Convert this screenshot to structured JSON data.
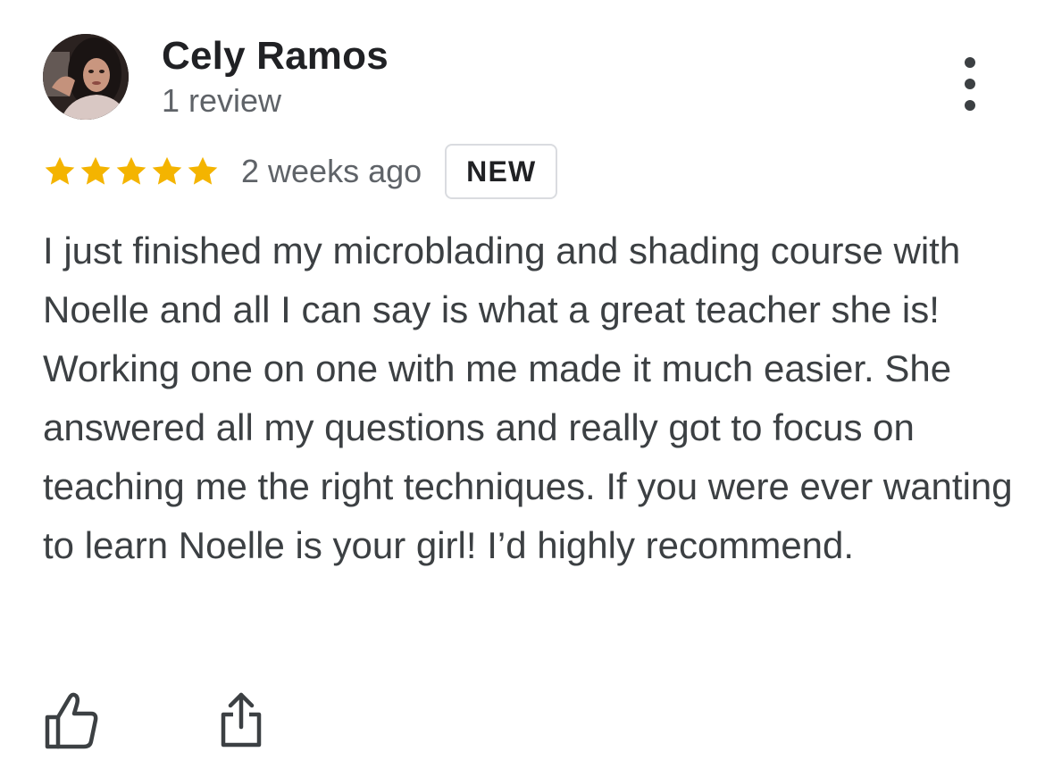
{
  "reviewer": {
    "name": "Cely Ramos",
    "review_count": "1 review"
  },
  "rating": {
    "stars": 5,
    "max_stars": 5,
    "star_color": "#f4b400",
    "date": "2 weeks ago",
    "badge": "NEW"
  },
  "review": {
    "text": "I just finished my microblading and shading course with Noelle and all I can say is what a great teacher she is! Working one on one with me made it much easier. She answered all my questions and really got to focus on teaching me the right techniques. If you were ever wanting to learn Noelle is your girl! I’d highly recommend."
  },
  "icons": {
    "more": "more-vert-icon",
    "like": "thumb-up-icon",
    "share": "share-icon"
  },
  "colors": {
    "text_primary": "#202124",
    "text_secondary": "#5f6368",
    "badge_border": "#dadce0"
  }
}
